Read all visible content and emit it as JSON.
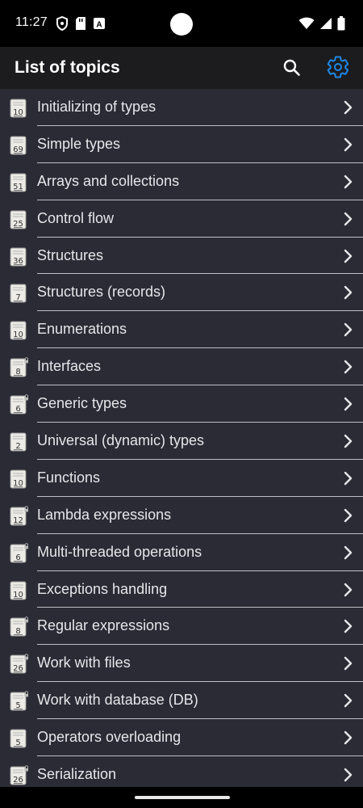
{
  "status_bar": {
    "time": "11:27",
    "left_icons": [
      "vpn-shield-icon",
      "sd-card-icon",
      "keyboard-a-icon"
    ],
    "right_icons": [
      "wifi-icon",
      "signal-icon",
      "battery-icon"
    ]
  },
  "app_bar": {
    "title": "List of topics",
    "search_icon": "search-icon",
    "settings_icon": "gear-icon",
    "settings_color": "#1e88e5"
  },
  "topics": [
    {
      "label": "Initializing of types",
      "count": "10",
      "locked": false
    },
    {
      "label": "Simple types",
      "count": "69",
      "locked": false
    },
    {
      "label": "Arrays and collections",
      "count": "51",
      "locked": false
    },
    {
      "label": "Control flow",
      "count": "25",
      "locked": false
    },
    {
      "label": "Structures",
      "count": "36",
      "locked": false
    },
    {
      "label": "Structures (records)",
      "count": "7",
      "locked": false
    },
    {
      "label": "Enumerations",
      "count": "10",
      "locked": false
    },
    {
      "label": "Interfaces",
      "count": "8",
      "locked": true
    },
    {
      "label": "Generic types",
      "count": "6",
      "locked": true
    },
    {
      "label": "Universal (dynamic) types",
      "count": "2",
      "locked": false
    },
    {
      "label": "Functions",
      "count": "10",
      "locked": false
    },
    {
      "label": "Lambda expressions",
      "count": "12",
      "locked": true
    },
    {
      "label": "Multi-threaded operations",
      "count": "6",
      "locked": true
    },
    {
      "label": "Exceptions handling",
      "count": "10",
      "locked": false
    },
    {
      "label": "Regular expressions",
      "count": "8",
      "locked": true
    },
    {
      "label": "Work with files",
      "count": "26",
      "locked": true
    },
    {
      "label": "Work with database (DB)",
      "count": "5",
      "locked": true
    },
    {
      "label": "Operators overloading",
      "count": "5",
      "locked": false
    },
    {
      "label": "Serialization",
      "count": "26",
      "locked": true
    }
  ],
  "nav_bar": {
    "handle": "gesture-handle"
  }
}
